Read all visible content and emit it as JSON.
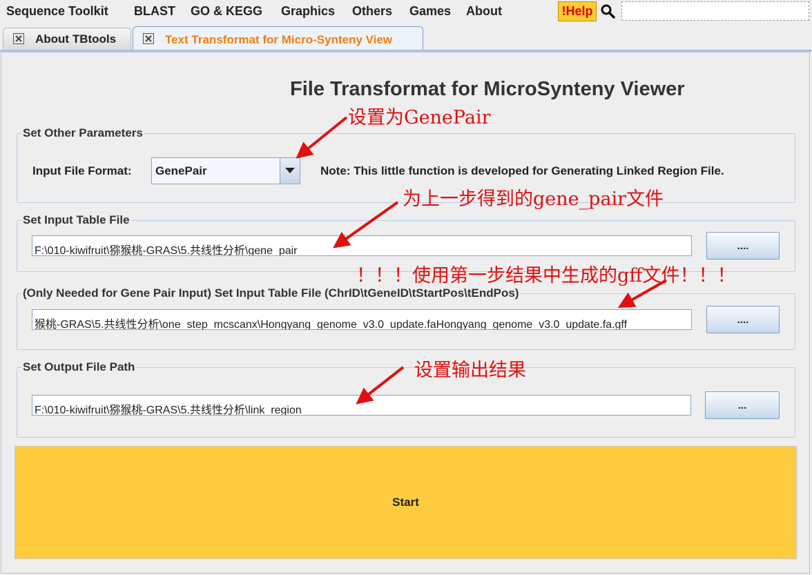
{
  "menubar": {
    "items": [
      "Sequence Toolkit",
      "BLAST",
      "GO & KEGG",
      "Graphics",
      "Others",
      "Games",
      "About"
    ],
    "help_label": "!Help",
    "search_placeholder": ""
  },
  "tabs": [
    {
      "label": "About TBtools",
      "active": false
    },
    {
      "label": "Text Transformat for Micro-Synteny View",
      "active": true
    }
  ],
  "main": {
    "title": "File Transformat for MicroSynteny Viewer",
    "other_params": {
      "legend": "Set Other Parameters",
      "format_label": "Input File Format:",
      "format_value": "GenePair",
      "note": "Note: This little function is developed for Generating Linked Region File."
    },
    "input_table": {
      "legend": "Set Input Table File",
      "value": "F:\\010-kiwifruit\\猕猴桃-GRAS\\5.共线性分析\\gene_pair",
      "button": "...."
    },
    "gene_pos": {
      "legend": "(Only Needed for Gene Pair Input) Set Input Table File (ChrID\\tGeneID\\tStartPos\\tEndPos)",
      "value": "猴桃-GRAS\\5.共线性分析\\one_step_mcscanx\\Hongyang_genome_v3.0_update.faHongyang_genome_v3.0_update.fa.gff",
      "button": "...."
    },
    "output": {
      "legend": "Set Output File Path",
      "value": "F:\\010-kiwifruit\\猕猴桃-GRAS\\5.共线性分析\\link_region",
      "button": "..."
    },
    "start_label": "Start"
  },
  "annotations": {
    "a1": "设置为GenePair",
    "a2": "为上一步得到的gene_pair文件",
    "a3": "！！！使用第一步结果中生成的gff文件！！！",
    "a4": "设置输出结果"
  },
  "colors": {
    "accent_tab": "#f07d10",
    "help_bg": "#ffcc33",
    "start_bg": "#ffcc3f",
    "annotation": "#e01010"
  }
}
